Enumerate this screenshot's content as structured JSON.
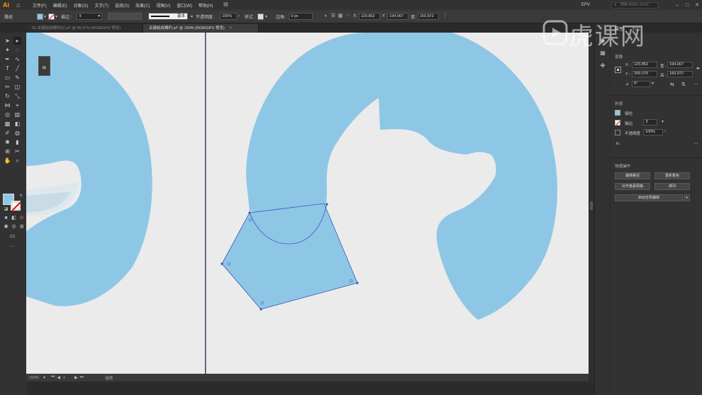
{
  "menubar": {
    "app_logo": "Ai",
    "items": [
      "文件(F)",
      "编辑(E)",
      "对象(O)",
      "文字(T)",
      "选择(S)",
      "效果(C)",
      "视图(V)",
      "窗口(W)",
      "帮助(H)"
    ],
    "workspace": "EPV",
    "search_placeholder": "搜索 Adobe Stock"
  },
  "controlbar": {
    "selection_label": "路径",
    "stroke_label": "描边 :",
    "stroke_style": "基本",
    "opacity_label": "不透明度 :",
    "opacity_value": "100%",
    "style_label": "样式 :",
    "corner_label": "边角 :",
    "corner_value": "0 px",
    "x_value": "120.852",
    "y_value": "194.067",
    "w_value": "150.972",
    "fill_color": "#8ec7e6"
  },
  "doc_tabs": [
    {
      "label": "02.关键结成模约02.ai* @ 96.97% (RGB/GPU 预览)",
      "active": false
    },
    {
      "label": "关键结成模约.ai* @ 150% (RGB/GPU 预览)",
      "active": true
    }
  ],
  "status": {
    "zoom": "150%",
    "artboard": "1",
    "tool_state": "选择"
  },
  "right_panel": {
    "tabs": [
      "属性",
      "图层"
    ],
    "transform_title": "变换",
    "x_label": "X :",
    "x_value": "120.852",
    "y_label": "Y :",
    "y_value": "209.079",
    "w_label": "宽 :",
    "w_value": "194.067",
    "h_label": "高 :",
    "h_value": "150.972",
    "angle_value": "0°",
    "appearance_title": "外观",
    "fill_label": "填色",
    "stroke_label": "描边",
    "opacity_label": "不透明度",
    "opacity_value": "100%",
    "fx_label": "fx.",
    "quick_actions_title": "快速操作",
    "btn_offset_path": "偏移路径",
    "btn_recolor": "重新着色",
    "btn_align_pixel": "对齐像素网格",
    "btn_arrange": "排列",
    "btn_image_trace": "启动全局编辑"
  },
  "watermark": "虎课网",
  "colors": {
    "shape_blue": "#8ec7e6",
    "canvas_bg": "#ebebeb",
    "selection_blue": "#3b55b8"
  }
}
